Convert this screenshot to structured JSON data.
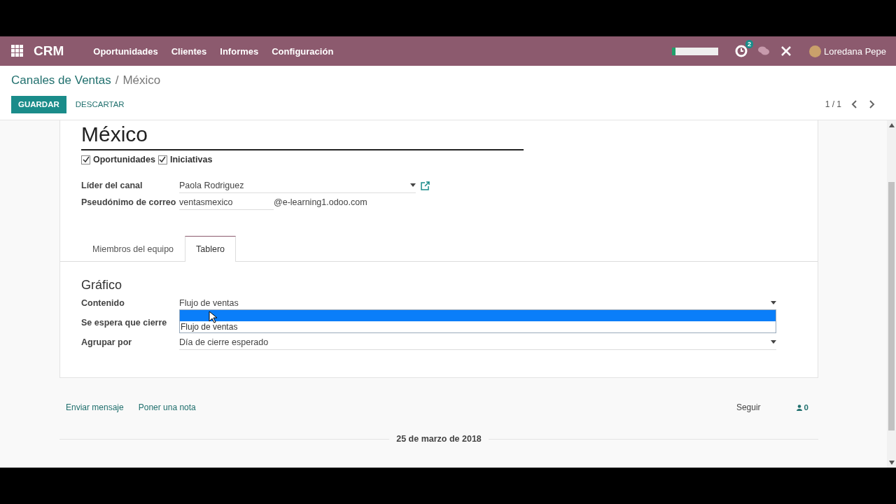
{
  "navbar": {
    "app_name": "CRM",
    "menu": [
      "Oportunidades",
      "Clientes",
      "Informes",
      "Configuración"
    ],
    "activity_count": "2",
    "user": "Loredana Pepe"
  },
  "breadcrumb": [
    {
      "label": "Canales de Ventas",
      "kind": "link"
    },
    {
      "label": "/",
      "kind": "separator"
    },
    {
      "label": "México",
      "kind": "current"
    }
  ],
  "buttons": [
    {
      "label": "GUARDAR",
      "kind": "primary"
    },
    {
      "label": "DESCARTAR",
      "kind": "link"
    }
  ],
  "pager": "1 / 1",
  "form": {
    "title": "México",
    "options": [
      {
        "label": "Oportunidades",
        "checked": true
      },
      {
        "label": "Iniciativas",
        "checked": true
      }
    ],
    "fields": [
      {
        "label": "Líder del canal",
        "value": "Paola Rodriguez",
        "kind": "many2one"
      },
      {
        "label": "Pseudónimo de correo",
        "value": "ventasmexico",
        "suffix": "@e-learning1.odoo.com",
        "kind": "alias"
      }
    ],
    "tabs": [
      {
        "label": "Miembros del equipo",
        "selected": false
      },
      {
        "label": "Tablero",
        "selected": true
      }
    ],
    "section_title": "Gráfico",
    "dashboard_fields": [
      {
        "label": "Contenido",
        "value": "Flujo de ventas"
      },
      {
        "label": "Se espera que cierre"
      },
      {
        "label": "Agrupar por",
        "value": "Día de cierre esperado"
      }
    ],
    "dropdown": {
      "options": [
        {
          "kind": "blank",
          "selected": true
        },
        {
          "kind": "text",
          "label": "Flujo de ventas",
          "selected": false
        }
      ]
    }
  },
  "chatter": {
    "actions": [
      "Enviar mensaje",
      "Poner una nota"
    ],
    "follow": "Seguir",
    "followers": "0",
    "date": "25 de marzo de 2018"
  }
}
